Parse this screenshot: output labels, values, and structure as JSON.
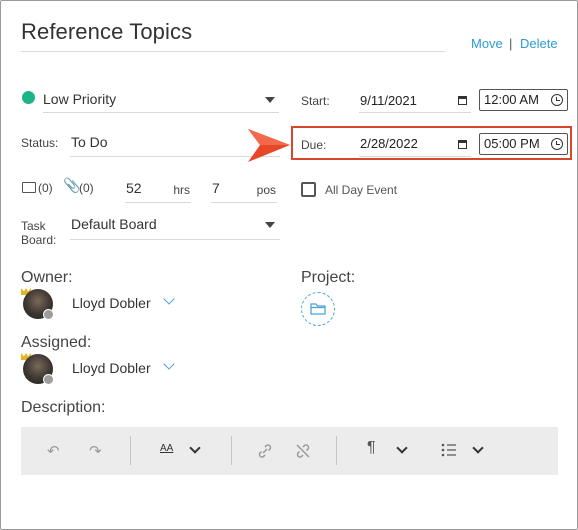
{
  "header": {
    "title": "Reference Topics",
    "move_label": "Move",
    "separator": "|",
    "delete_label": "Delete"
  },
  "priority": {
    "label": "Low Priority",
    "color": "#1fb38a"
  },
  "status": {
    "label": "Status:",
    "value": "To Do"
  },
  "counts": {
    "notes": "(0)",
    "attachments": "(0)",
    "hours": "52",
    "hours_unit": "hrs",
    "position": "7",
    "position_unit": "pos"
  },
  "task_board": {
    "label_line1": "Task",
    "label_line2": "Board:",
    "value": "Default Board"
  },
  "start": {
    "label": "Start:",
    "date": "9/11/2021",
    "time": "12:00 AM"
  },
  "due": {
    "label": "Due:",
    "date": "2/28/2022",
    "time": "05:00 PM",
    "highlight_color": "#d9472b"
  },
  "all_day": {
    "label": "All Day Event",
    "checked": false
  },
  "owner": {
    "label": "Owner:",
    "name": "Lloyd Dobler"
  },
  "assigned": {
    "label": "Assigned:",
    "name": "Lloyd Dobler"
  },
  "project": {
    "label": "Project:",
    "icon": "folder-icon"
  },
  "description": {
    "label": "Description:"
  },
  "toolbar": {
    "font_size_glyph": "AA",
    "icons": [
      "undo-icon",
      "redo-icon",
      "font-size-icon",
      "link-icon",
      "unlink-icon",
      "paragraph-icon",
      "list-icon"
    ]
  },
  "arrow_color": "#e8472a"
}
